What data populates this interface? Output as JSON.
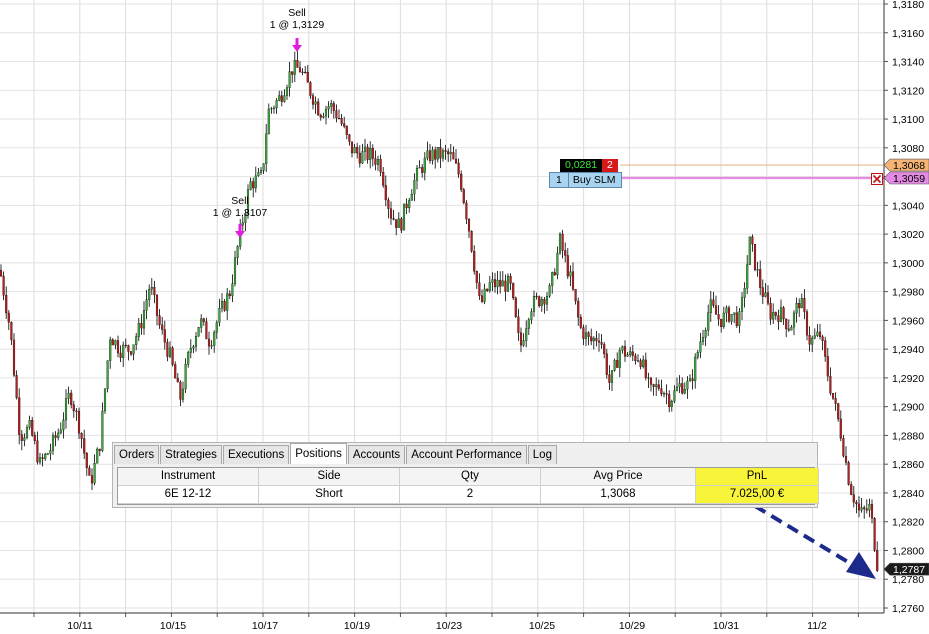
{
  "chart_data": {
    "type": "candlestick",
    "instrument": "6E 12-12",
    "ylim": [
      1.2765,
      1.3185
    ],
    "y_ticks": [
      "1,2760",
      "1,2780",
      "1,2800",
      "1,2820",
      "1,2840",
      "1,2860",
      "1,2880",
      "1,2900",
      "1,2920",
      "1,2940",
      "1,2960",
      "1,2980",
      "1,3000",
      "1,3020",
      "1,3040",
      "1,3060",
      "1,3080",
      "1,3100",
      "1,3120",
      "1,3140",
      "1,3160",
      "1,3180"
    ],
    "x_ticks": [
      "10/11",
      "10/15",
      "10/17",
      "10/19",
      "10/23",
      "10/25",
      "10/29",
      "10/31",
      "11/2"
    ],
    "close_path": [
      [
        0,
        1.2995
      ],
      [
        10,
        1.2955
      ],
      [
        20,
        1.288
      ],
      [
        30,
        1.2885
      ],
      [
        40,
        1.286
      ],
      [
        50,
        1.287
      ],
      [
        60,
        1.2885
      ],
      [
        70,
        1.291
      ],
      [
        80,
        1.2885
      ],
      [
        90,
        1.2845
      ],
      [
        100,
        1.2875
      ],
      [
        110,
        1.295
      ],
      [
        120,
        1.294
      ],
      [
        130,
        1.294
      ],
      [
        140,
        1.2955
      ],
      [
        150,
        1.2985
      ],
      [
        160,
        1.2955
      ],
      [
        170,
        1.2935
      ],
      [
        180,
        1.2905
      ],
      [
        190,
        1.294
      ],
      [
        200,
        1.296
      ],
      [
        210,
        1.2945
      ],
      [
        220,
        1.2965
      ],
      [
        230,
        1.298
      ],
      [
        240,
        1.302
      ],
      [
        250,
        1.3055
      ],
      [
        262,
        1.306
      ],
      [
        268,
        1.3105
      ],
      [
        280,
        1.3115
      ],
      [
        292,
        1.3135
      ],
      [
        300,
        1.3135
      ],
      [
        310,
        1.312
      ],
      [
        320,
        1.3105
      ],
      [
        330,
        1.311
      ],
      [
        340,
        1.31
      ],
      [
        350,
        1.308
      ],
      [
        360,
        1.3075
      ],
      [
        370,
        1.3075
      ],
      [
        380,
        1.307
      ],
      [
        390,
        1.3035
      ],
      [
        400,
        1.3025
      ],
      [
        410,
        1.305
      ],
      [
        420,
        1.3065
      ],
      [
        430,
        1.3075
      ],
      [
        440,
        1.3075
      ],
      [
        450,
        1.3075
      ],
      [
        460,
        1.306
      ],
      [
        470,
        1.302
      ],
      [
        480,
        1.297
      ],
      [
        490,
        1.2985
      ],
      [
        500,
        1.2985
      ],
      [
        510,
        1.2985
      ],
      [
        520,
        1.294
      ],
      [
        530,
        1.297
      ],
      [
        540,
        1.2975
      ],
      [
        550,
        1.298
      ],
      [
        560,
        1.3015
      ],
      [
        570,
        1.299
      ],
      [
        580,
        1.2955
      ],
      [
        590,
        1.2945
      ],
      [
        600,
        1.295
      ],
      [
        610,
        1.2915
      ],
      [
        620,
        1.294
      ],
      [
        630,
        1.2935
      ],
      [
        640,
        1.2935
      ],
      [
        650,
        1.291
      ],
      [
        660,
        1.2915
      ],
      [
        670,
        1.2905
      ],
      [
        680,
        1.2915
      ],
      [
        690,
        1.2915
      ],
      [
        700,
        1.2945
      ],
      [
        710,
        1.297
      ],
      [
        720,
        1.296
      ],
      [
        730,
        1.2965
      ],
      [
        740,
        1.296
      ],
      [
        750,
        1.3015
      ],
      [
        760,
        1.2985
      ],
      [
        770,
        1.2965
      ],
      [
        780,
        1.2965
      ],
      [
        790,
        1.2955
      ],
      [
        800,
        1.2975
      ],
      [
        810,
        1.2945
      ],
      [
        820,
        1.295
      ],
      [
        830,
        1.2915
      ],
      [
        840,
        1.2885
      ],
      [
        850,
        1.2845
      ],
      [
        860,
        1.2825
      ],
      [
        870,
        1.283
      ],
      [
        878,
        1.2787
      ]
    ],
    "annotations": [
      {
        "label_1": "Sell",
        "label_2": "1 @ 1,3129",
        "price": 1.3129
      },
      {
        "label_1": "Sell",
        "label_2": "1 @ 1,3107",
        "price": 1.3107
      }
    ],
    "price_markers": [
      {
        "label": "1,3068",
        "price": 1.3068,
        "color": "#f5b475",
        "line": "#e8ba8c"
      },
      {
        "label": "1,3059",
        "price": 1.3059,
        "color": "#e38ae3",
        "line": "#e48be4"
      },
      {
        "label": "1,2787",
        "price": 1.2787,
        "color": "#1a1a1a",
        "line": "#1a1a1a"
      }
    ]
  },
  "position_tag": {
    "pnl": "0,0281",
    "qty": "2"
  },
  "order_tag": {
    "qty": "1",
    "label": "Buy SLM"
  },
  "cancel_icon": "close-icon",
  "panel": {
    "tabs": [
      "Orders",
      "Strategies",
      "Executions",
      "Positions",
      "Accounts",
      "Account Performance",
      "Log"
    ],
    "active_tab": "Positions",
    "columns": [
      "Instrument",
      "Side",
      "Qty",
      "Avg Price",
      "PnL"
    ],
    "row": [
      "6E 12-12",
      "Short",
      "2",
      "1,3068",
      "7.025,00 €"
    ],
    "highlight_color": "#f8f43a"
  },
  "arrow_color": "#1c2a8c"
}
